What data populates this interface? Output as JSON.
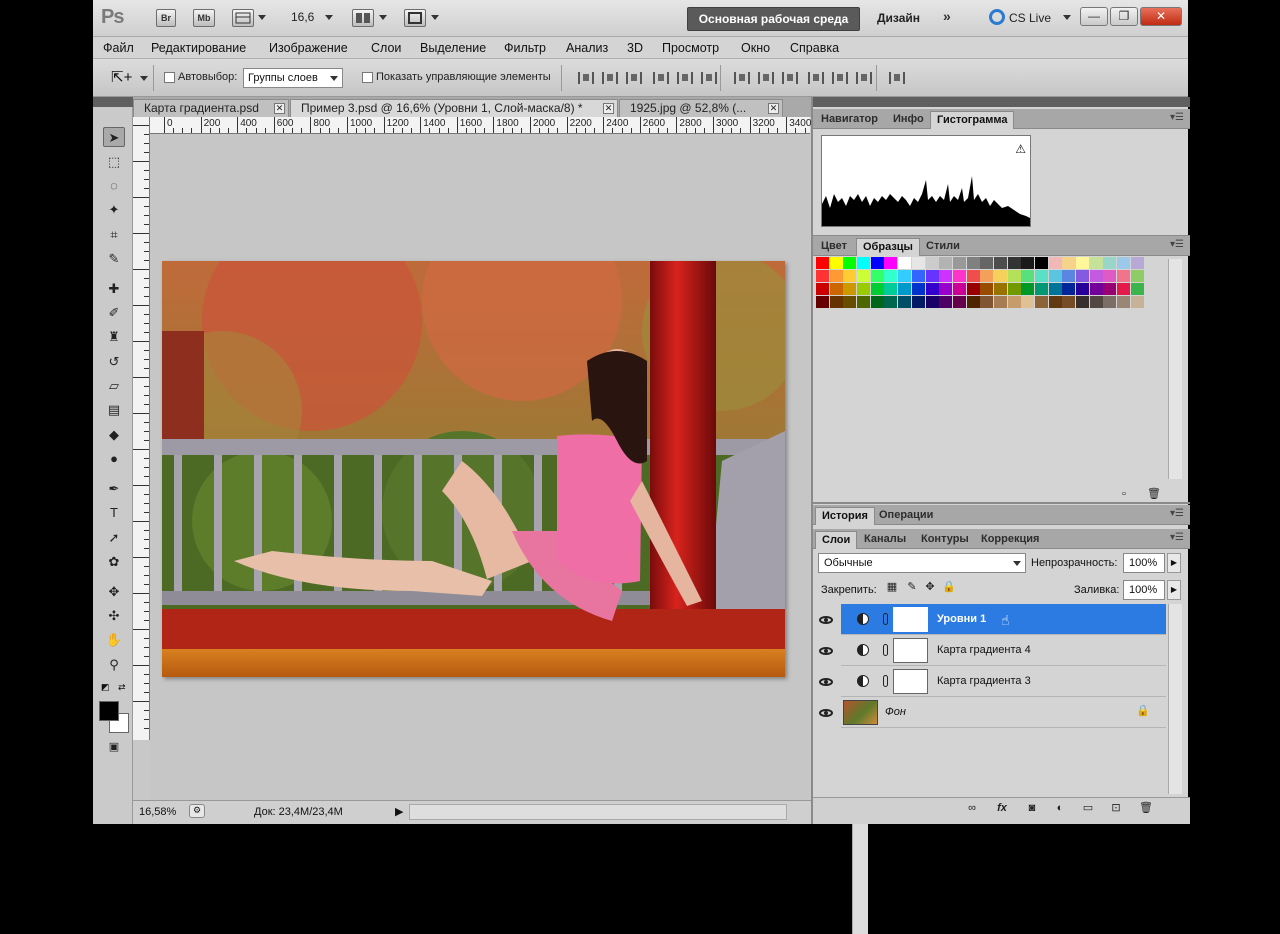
{
  "app": {
    "logo": "Ps",
    "icons": [
      "Br",
      "Mb"
    ],
    "zoom": "16,6",
    "workspace_main": "Основная рабочая среда",
    "workspace_design": "Дизайн",
    "workspace_more": "»",
    "cs_live": "CS Live",
    "window_controls": {
      "minimize": "—",
      "restore": "❐",
      "close": "✕"
    }
  },
  "menu": [
    "Файл",
    "Редактирование",
    "Изображение",
    "Слои",
    "Выделение",
    "Фильтр",
    "Анализ",
    "3D",
    "Просмотр",
    "Окно",
    "Справка"
  ],
  "options": {
    "autoselect_label": "Автовыбор:",
    "autoselect_value": "Группы слоев",
    "show_controls_label": "Показать управляющие элементы"
  },
  "doc_tabs": [
    {
      "label": "Карта градиента.psd",
      "active": false
    },
    {
      "label": "Пример 3.psd @ 16,6% (Уровни 1, Слой-маска/8) *",
      "active": true
    },
    {
      "label": "1925.jpg @ 52,8% (...",
      "active": false
    }
  ],
  "ruler": {
    "labels": [
      "0",
      "200",
      "400",
      "600",
      "800",
      "1000",
      "1200",
      "1400",
      "1600",
      "1800",
      "2000",
      "2200",
      "2400",
      "2600",
      "2800",
      "3000",
      "3200",
      "3400"
    ]
  },
  "status": {
    "zoom": "16,58%",
    "doc_info": "Док: 23,4M/23,4M"
  },
  "panels": {
    "top_tabs": [
      "Навигатор",
      "Инфо",
      "Гистограмма"
    ],
    "top_active": "Гистограмма",
    "swatch_tabs": [
      "Цвет",
      "Образцы",
      "Стили"
    ],
    "swatch_active": "Образцы",
    "history_tabs": [
      "История",
      "Операции"
    ],
    "history_active": "История",
    "layer_tabs": [
      "Слои",
      "Каналы",
      "Контуры",
      "Коррекция"
    ],
    "layer_active": "Слои"
  },
  "swatch_colors": [
    "#ff0000",
    "#ffff00",
    "#00ff00",
    "#00ffff",
    "#0000ff",
    "#ff00ff",
    "#ffffff",
    "#e6e6e6",
    "#cccccc",
    "#b3b3b3",
    "#999999",
    "#808080",
    "#666666",
    "#4d4d4d",
    "#333333",
    "#1a1a1a",
    "#000000",
    "#f2b8b8",
    "#f5d38b",
    "#fff799",
    "#c6e29a",
    "#99d5c9",
    "#9cc8ea",
    "#b7a8d6",
    "#ff3333",
    "#ff9933",
    "#ffcc33",
    "#ccff33",
    "#33ff66",
    "#33ffcc",
    "#33ccff",
    "#3366ff",
    "#6633ff",
    "#cc33ff",
    "#ff33cc",
    "#f04d4d",
    "#f5a05a",
    "#f5d05a",
    "#b5e05a",
    "#5ae07a",
    "#5ae0c5",
    "#5ac5e0",
    "#5a85e0",
    "#855ae0",
    "#c55ae0",
    "#e05ac5",
    "#f2738c",
    "#8fcc66",
    "#cc0000",
    "#cc6600",
    "#cc9900",
    "#99cc00",
    "#00cc33",
    "#00cc99",
    "#0099cc",
    "#0033cc",
    "#3300cc",
    "#9900cc",
    "#cc0099",
    "#990000",
    "#994c00",
    "#997300",
    "#739900",
    "#009926",
    "#009973",
    "#007399",
    "#002699",
    "#260099",
    "#730099",
    "#990073",
    "#e6194b",
    "#3cb44b",
    "#660000",
    "#663300",
    "#664d00",
    "#4d6600",
    "#00661a",
    "#00664d",
    "#004d66",
    "#001a66",
    "#1a0066",
    "#4d0066",
    "#66004d",
    "#4d2600",
    "#805533",
    "#a67c52",
    "#c69c6d",
    "#e0c097",
    "#8c6239",
    "#603913",
    "#754c24",
    "#362f2d",
    "#534741",
    "#7a6e66",
    "#998675",
    "#c7b299"
  ],
  "layers_panel": {
    "blend_mode": "Обычные",
    "opacity_label": "Непрозрачность:",
    "opacity_value": "100%",
    "lock_label": "Закрепить:",
    "fill_label": "Заливка:",
    "fill_value": "100%",
    "layers": [
      {
        "name": "Уровни 1",
        "selected": true,
        "type": "adjustment"
      },
      {
        "name": "Карта градиента 4",
        "selected": false,
        "type": "adjustment"
      },
      {
        "name": "Карта градиента 3",
        "selected": false,
        "type": "adjustment"
      },
      {
        "name": "Фон",
        "selected": false,
        "type": "background"
      }
    ]
  }
}
